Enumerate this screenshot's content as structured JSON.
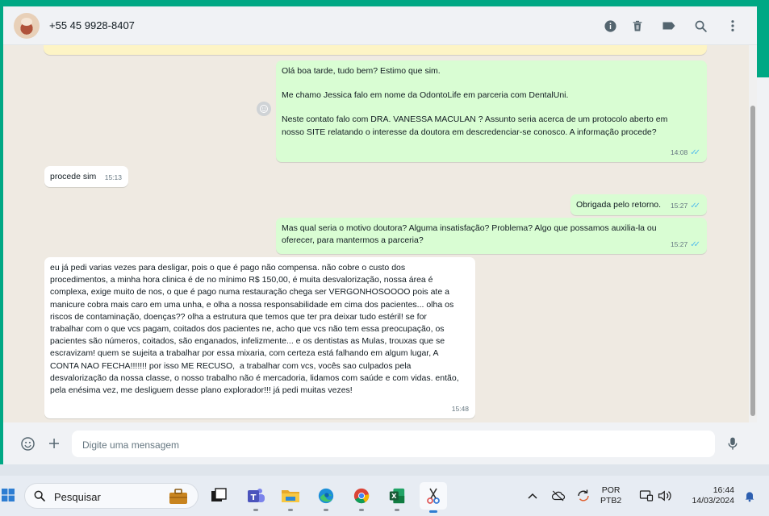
{
  "header": {
    "contact_name": "+55 45 9928-8407",
    "icons": [
      "info-icon",
      "trash-icon",
      "label-icon",
      "search-icon",
      "more-vert-icon"
    ]
  },
  "messages": [
    {
      "direction": "out",
      "paragraphs": [
        "Olá boa tarde, tudo bem? Estimo que sim.",
        "Me chamo Jessica falo em nome da OdontoLife em parceria com DentalUni.",
        "Neste contato falo com DRA. VANESSA MACULAN ? Assunto seria acerca de um protocolo aberto em nosso SITE relatando o interesse da doutora em descredenciar-se conosco. A informação procede?"
      ],
      "time": "14:08"
    },
    {
      "direction": "in",
      "text": "procede sim",
      "time": "15:13"
    },
    {
      "direction": "out",
      "text": "Obrigada pelo retorno.",
      "time": "15:27"
    },
    {
      "direction": "out",
      "text": "Mas qual seria o motivo doutora? Alguma insatisfação? Problema? Algo que possamos auxilia-la ou oferecer, para mantermos a parceria?",
      "time": "15:27"
    },
    {
      "direction": "in",
      "text": "eu já pedi varias vezes para desligar, pois o que é pago não compensa. não cobre o custo dos procedimentos, a minha hora clinica é de no mínimo R$ 150,00, é muita desvalorização, nossa área é complexa, exige muito de nos, o que é pago numa restauração chega ser VERGONHOSOOOO pois ate a manicure cobra mais caro em uma unha, e olha a nossa responsabilidade em cima dos pacientes... olha os riscos de contaminação, doenças?? olha a estrutura que temos que ter pra deixar tudo estéril! se for trabalhar com o que vcs pagam, coitados dos pacientes ne, acho que vcs não tem essa preocupação, os pacientes são números, coitados, são enganados, infelizmente... e os dentistas as Mulas, trouxas que se escravizam! quem se sujeita a trabalhar por essa mixaria, com certeza está falhando em algum lugar, A CONTA NAO FECHA!!!!!!! por isso ME RECUSO,  a trabalhar com vcs, vocês sao culpados pela desvalorização da nossa classe, o nosso trabalho não é mercadoria, lidamos com saúde e com vidas. então, pela enésima vez, me desliguem desse plano explorador!!! já pedi muitas vezes!",
      "time": "15:48"
    }
  ],
  "composer": {
    "placeholder": "Digite uma mensagem"
  },
  "taskbar": {
    "search_label": "Pesquisar",
    "language": "POR",
    "keyboard": "PTB2",
    "time": "16:44",
    "date": "14/03/2024"
  },
  "colors": {
    "accent": "#00a884",
    "outgoing_bubble": "#d9fdd3",
    "incoming_bubble": "#ffffff",
    "chat_bg": "#efeae2",
    "read_ticks": "#53bdeb"
  }
}
